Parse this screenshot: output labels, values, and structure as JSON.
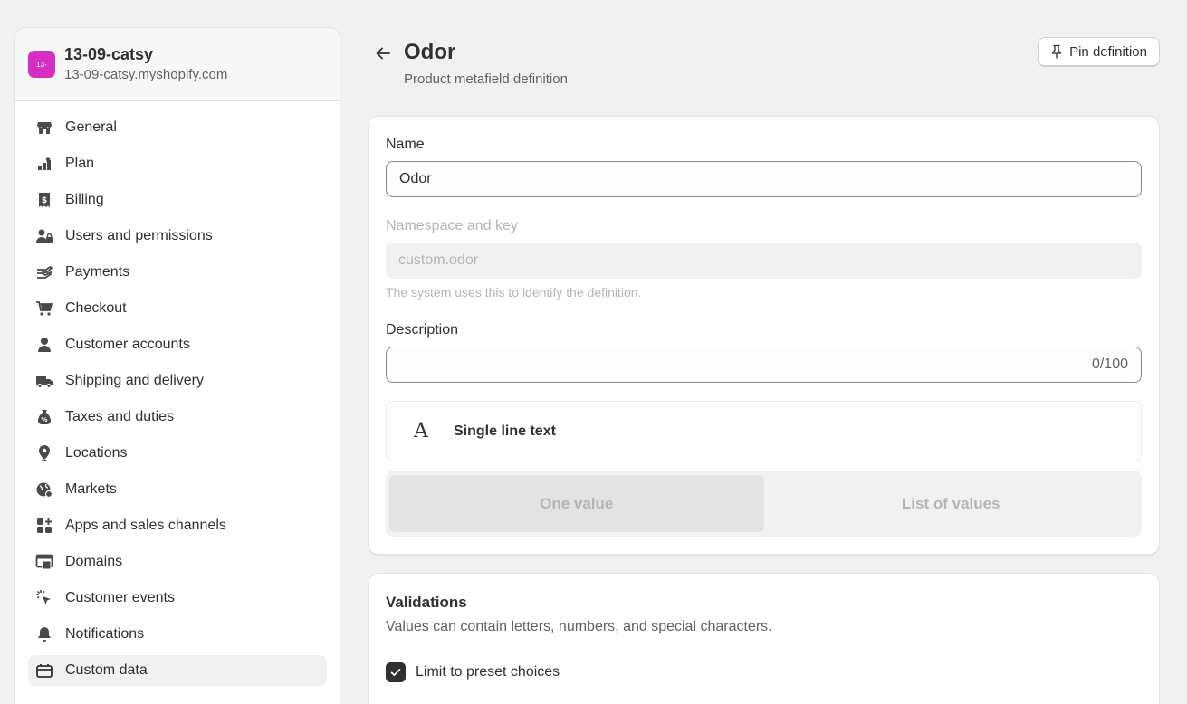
{
  "store": {
    "avatar_text": "13-",
    "name": "13-09-catsy",
    "domain": "13-09-catsy.myshopify.com",
    "avatar_color": "#d42fc0"
  },
  "sidebar": {
    "items": [
      {
        "label": "General",
        "icon": "store-icon"
      },
      {
        "label": "Plan",
        "icon": "plan-icon"
      },
      {
        "label": "Billing",
        "icon": "billing-icon"
      },
      {
        "label": "Users and permissions",
        "icon": "users-icon"
      },
      {
        "label": "Payments",
        "icon": "payments-icon"
      },
      {
        "label": "Checkout",
        "icon": "cart-icon"
      },
      {
        "label": "Customer accounts",
        "icon": "person-icon"
      },
      {
        "label": "Shipping and delivery",
        "icon": "truck-icon"
      },
      {
        "label": "Taxes and duties",
        "icon": "tax-icon"
      },
      {
        "label": "Locations",
        "icon": "location-pin-icon"
      },
      {
        "label": "Markets",
        "icon": "globe-icon"
      },
      {
        "label": "Apps and sales channels",
        "icon": "apps-icon"
      },
      {
        "label": "Domains",
        "icon": "domains-icon"
      },
      {
        "label": "Customer events",
        "icon": "cursor-click-icon"
      },
      {
        "label": "Notifications",
        "icon": "bell-icon"
      },
      {
        "label": "Custom data",
        "icon": "custom-data-icon",
        "active": true
      }
    ]
  },
  "header": {
    "title": "Odor",
    "subtitle": "Product metafield definition",
    "pin_label": "Pin definition"
  },
  "form": {
    "name_label": "Name",
    "name_value": "Odor",
    "namespace_label": "Namespace and key",
    "namespace_value": "custom.odor",
    "namespace_help": "The system uses this to identify the definition.",
    "description_label": "Description",
    "description_value": "",
    "description_counter": "0/100",
    "type_icon": "A",
    "type_label": "Single line text",
    "one_value_label": "One value",
    "list_values_label": "List of values"
  },
  "validations": {
    "title": "Validations",
    "description": "Values can contain letters, numbers, and special characters.",
    "limit_label": "Limit to preset choices",
    "limit_checked": true
  }
}
